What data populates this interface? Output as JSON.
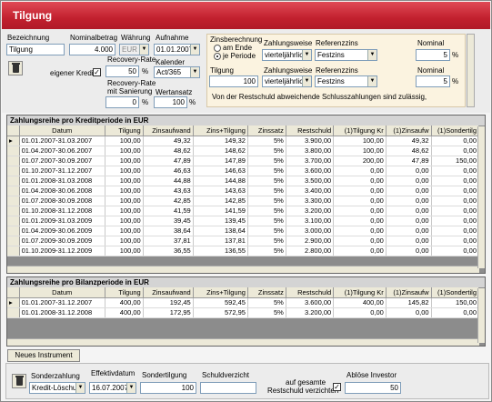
{
  "title": "Tilgung",
  "form": {
    "bezeichnung_label": "Bezeichnung",
    "bezeichnung_value": "Tilgung",
    "nominalbetrag_label": "Nominalbetrag",
    "nominalbetrag_value": "4.000",
    "waehrung_label": "Währung",
    "waehrung_value": "EUR",
    "aufnahme_label": "Aufnahme",
    "aufnahme_value": "01.01.2007",
    "eigener_kredit_label": "eigener Kredit",
    "recovery_rate_label": "Recovery-Rate",
    "recovery_rate_value": "50",
    "recovery_sanierung_label1": "Recovery-Rate",
    "recovery_sanierung_label2": "mit Sanierung",
    "recovery_sanierung_value": "0",
    "kalender_label": "Kalender",
    "kalender_value": "Act/365",
    "wertansatz_label": "Wertansatz",
    "wertansatz_value": "100",
    "percent": "%"
  },
  "zins": {
    "berechnung_label": "Zinsberechnung",
    "am_ende": "am Ende",
    "je_periode": "je Periode",
    "zahlungsweise_label": "Zahlungsweise",
    "zahlungsweise_value": "vierteljährlich",
    "referenzzins_label": "Referenzzins",
    "referenzzins_value": "Festzins",
    "nominal_label": "Nominal",
    "nominal_value": "5",
    "tilgung_label": "Tilgung",
    "tilgung_value": "100",
    "zahlungsweise2_label": "Zahlungsweise",
    "zahlungsweise2_value": "vierteljährlich",
    "referenzzins2_label": "Referenzzins",
    "referenzzins2_value": "Festzins",
    "nominal2_label": "Nominal",
    "nominal2_value": "5",
    "note": "Von der Restschuld abweichende Schlusszahlungen sind zulässig,"
  },
  "grid1": {
    "title": "Zahlungsreihe pro Kreditperiode in EUR",
    "columns": [
      "Datum",
      "Tilgung",
      "Zinsaufwand",
      "Zins+Tilgung",
      "Zinssatz",
      "Restschuld",
      "(1)Tilgung Kr",
      "(1)Zinsaufw",
      "(1)Sondertilg"
    ],
    "rows": [
      [
        "01.01.2007-31.03.2007",
        "100,00",
        "49,32",
        "149,32",
        "5%",
        "3.900,00",
        "100,00",
        "49,32",
        "0,00"
      ],
      [
        "01.04.2007-30.06.2007",
        "100,00",
        "48,62",
        "148,62",
        "5%",
        "3.800,00",
        "100,00",
        "48,62",
        "0,00"
      ],
      [
        "01.07.2007-30.09.2007",
        "100,00",
        "47,89",
        "147,89",
        "5%",
        "3.700,00",
        "200,00",
        "47,89",
        "150,00"
      ],
      [
        "01.10.2007-31.12.2007",
        "100,00",
        "46,63",
        "146,63",
        "5%",
        "3.600,00",
        "0,00",
        "0,00",
        "0,00"
      ],
      [
        "01.01.2008-31.03.2008",
        "100,00",
        "44,88",
        "144,88",
        "5%",
        "3.500,00",
        "0,00",
        "0,00",
        "0,00"
      ],
      [
        "01.04.2008-30.06.2008",
        "100,00",
        "43,63",
        "143,63",
        "5%",
        "3.400,00",
        "0,00",
        "0,00",
        "0,00"
      ],
      [
        "01.07.2008-30.09.2008",
        "100,00",
        "42,85",
        "142,85",
        "5%",
        "3.300,00",
        "0,00",
        "0,00",
        "0,00"
      ],
      [
        "01.10.2008-31.12.2008",
        "100,00",
        "41,59",
        "141,59",
        "5%",
        "3.200,00",
        "0,00",
        "0,00",
        "0,00"
      ],
      [
        "01.01.2009-31.03.2009",
        "100,00",
        "39,45",
        "139,45",
        "5%",
        "3.100,00",
        "0,00",
        "0,00",
        "0,00"
      ],
      [
        "01.04.2009-30.06.2009",
        "100,00",
        "38,64",
        "138,64",
        "5%",
        "3.000,00",
        "0,00",
        "0,00",
        "0,00"
      ],
      [
        "01.07.2009-30.09.2009",
        "100,00",
        "37,81",
        "137,81",
        "5%",
        "2.900,00",
        "0,00",
        "0,00",
        "0,00"
      ],
      [
        "01.10.2009-31.12.2009",
        "100,00",
        "36,55",
        "136,55",
        "5%",
        "2.800,00",
        "0,00",
        "0,00",
        "0,00"
      ]
    ]
  },
  "grid2": {
    "title": "Zahlungsreihe pro Bilanzperiode in EUR",
    "columns": [
      "Datum",
      "Tilgung",
      "Zinsaufwand",
      "Zins+Tilgung",
      "Zinssatz",
      "Restschuld",
      "(1)Tilgung Kr",
      "(1)Zinsaufw",
      "(1)Sondertilg"
    ],
    "rows": [
      [
        "01.01.2007-31.12.2007",
        "400,00",
        "192,45",
        "592,45",
        "5%",
        "3.600,00",
        "400,00",
        "145,82",
        "150,00"
      ],
      [
        "01.01.2008-31.12.2008",
        "400,00",
        "172,95",
        "572,95",
        "5%",
        "3.200,00",
        "0,00",
        "0,00",
        "0,00"
      ]
    ]
  },
  "neues_instrument": "Neues Instrument",
  "bottom": {
    "sonderzahlung_label": "Sonderzahlung",
    "sonderzahlung_value": "Kredit-Löschung",
    "effektivdatum_label": "Effektivdatum",
    "effektivdatum_value": "16.07.2007",
    "sondertilgung_label": "Sondertilgung",
    "sondertilgung_value": "100",
    "schuldverzicht_label": "Schuldverzicht",
    "auf_gesamte_label1": "auf gesamte",
    "auf_gesamte_label2": "Restschuld verzichten",
    "abloese_label": "Ablöse Investor",
    "abloese_value": "50"
  }
}
